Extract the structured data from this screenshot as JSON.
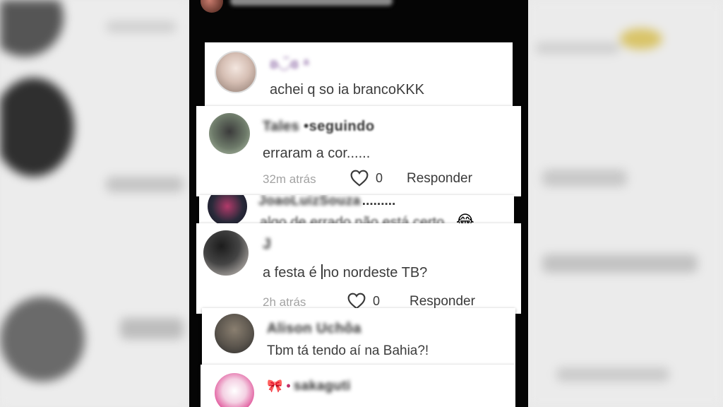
{
  "comments": [
    {
      "username": "ʚ◡̈ɞ ᵃ",
      "text": "achei q so ia brancoKKK"
    },
    {
      "username": "Tales",
      "badge": "•seguindo",
      "text": "erraram a cor......",
      "time": "32m atrás",
      "likes": "0",
      "reply_label": "Responder"
    },
    {
      "username": "JoaoLuizSouza",
      "username_suffix": ".........",
      "text": "algo de errado não está certo",
      "emoji": "😂"
    },
    {
      "username": "J",
      "text_before_cursor": "a festa é ",
      "text_after_cursor": "no nordeste TB?",
      "time": "2h atrás",
      "likes": "0",
      "reply_label": "Responder"
    },
    {
      "username": "Alison Uchôa",
      "text": "Tbm tá tendo aí na Bahia?!"
    },
    {
      "username_prefix": "🎀 •",
      "username": "sakaguti"
    }
  ],
  "icons": {
    "like": "heart-outline-icon"
  },
  "colors": {
    "phone_background": "#050505",
    "card_background": "#ffffff",
    "secondary_text": "#a3a3a3",
    "primary_text": "#3a3a3a"
  }
}
